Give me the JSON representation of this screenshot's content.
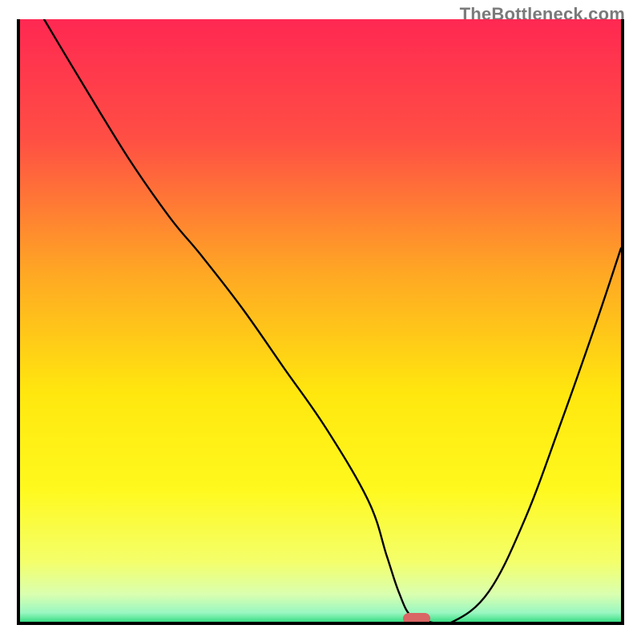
{
  "watermark": "TheBottleneck.com",
  "chart_data": {
    "type": "line",
    "title": "",
    "xlabel": "",
    "ylabel": "",
    "xlim": [
      0,
      100
    ],
    "ylim": [
      0,
      100
    ],
    "grid": false,
    "legend": false,
    "background_gradient": [
      {
        "pos": 0.0,
        "color": "#ff2852"
      },
      {
        "pos": 0.2,
        "color": "#ff4f44"
      },
      {
        "pos": 0.42,
        "color": "#ffa724"
      },
      {
        "pos": 0.62,
        "color": "#ffe70e"
      },
      {
        "pos": 0.78,
        "color": "#fff91e"
      },
      {
        "pos": 0.9,
        "color": "#f4ff6a"
      },
      {
        "pos": 0.955,
        "color": "#d9ffb0"
      },
      {
        "pos": 0.985,
        "color": "#99f7c1"
      },
      {
        "pos": 1.0,
        "color": "#3cdf86"
      }
    ],
    "series": [
      {
        "name": "curve",
        "x": [
          4,
          10,
          18,
          25,
          30,
          37,
          44,
          51,
          58,
          61,
          63,
          65,
          68,
          72,
          78,
          84,
          90,
          96,
          100
        ],
        "y": [
          100,
          90,
          77,
          67,
          61,
          52,
          42,
          32,
          20,
          11,
          5,
          1,
          0,
          0,
          5,
          17,
          33,
          50,
          62
        ]
      }
    ],
    "marker": {
      "x": 66,
      "y": 0,
      "shape": "pill",
      "color": "#da6565"
    }
  }
}
